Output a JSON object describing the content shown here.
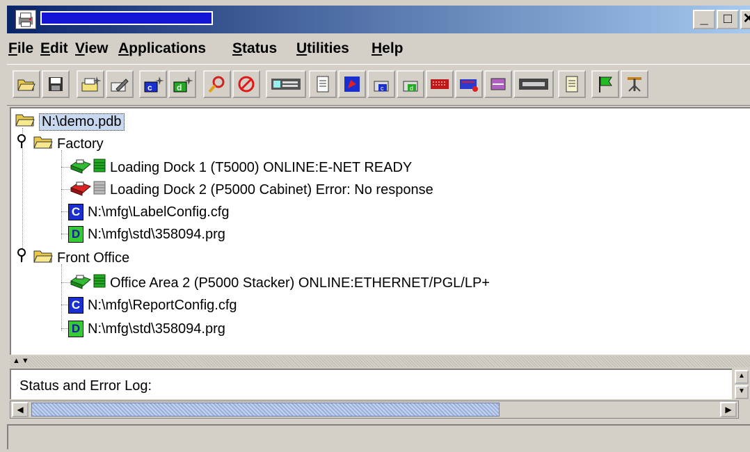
{
  "window": {
    "title": "",
    "buttons": {
      "minimize": "_",
      "maximize": "□",
      "close": "✕"
    }
  },
  "menu": [
    {
      "label": "File",
      "mnemonic": "F"
    },
    {
      "label": "Edit",
      "mnemonic": "E"
    },
    {
      "label": "View",
      "mnemonic": "V"
    },
    {
      "label": "Applications",
      "mnemonic": "A"
    },
    {
      "label": "Status",
      "mnemonic": "S"
    },
    {
      "label": "Utilities",
      "mnemonic": "U"
    },
    {
      "label": "Help",
      "mnemonic": "H"
    }
  ],
  "toolbar": [
    "open-folder-icon",
    "save-icon",
    "new-printer-icon",
    "edit-printer-icon",
    "new-config-icon",
    "new-data-icon",
    "find-icon",
    "stop-icon",
    "printer-panel-icon",
    "printer-document-icon",
    "print-icon",
    "config-printer-icon",
    "data-printer-icon",
    "status-red-icon",
    "status-blue-icon",
    "diagnostics-icon",
    "printer-panel-2-icon",
    "properties-icon",
    "flag-icon",
    "tools-icon"
  ],
  "tree": {
    "root": "N:\\demo.pdb",
    "groups": [
      {
        "label": "Factory",
        "items": [
          {
            "type": "printer",
            "status": "online",
            "label": "Loading Dock 1 (T5000) ONLINE:E-NET READY"
          },
          {
            "type": "printer",
            "status": "error",
            "label": "Loading Dock 2 (P5000 Cabinet) Error: No response"
          },
          {
            "type": "config",
            "badge": "C",
            "label": "N:\\mfg\\LabelConfig.cfg"
          },
          {
            "type": "data",
            "badge": "D",
            "label": "N:\\mfg\\std\\358094.prg"
          }
        ]
      },
      {
        "label": "Front Office",
        "items": [
          {
            "type": "printer",
            "status": "online",
            "label": "Office Area 2 (P5000 Stacker) ONLINE:ETHERNET/PGL/LP+"
          },
          {
            "type": "config",
            "badge": "C",
            "label": "N:\\mfg\\ReportConfig.cfg"
          },
          {
            "type": "data",
            "badge": "D",
            "label": "N:\\mfg\\std\\358094.prg"
          }
        ]
      }
    ]
  },
  "log": {
    "label": "Status and Error Log:"
  },
  "scroll": {
    "left": "◀",
    "right": "▶",
    "up": "▲",
    "down": "▼",
    "position": 0.68
  },
  "colors": {
    "title_start": "#0a246a",
    "title_end": "#a6caf0",
    "online": "#22aa22",
    "error": "#cc1111",
    "config": "#1a2fd0",
    "data": "#33cc33"
  }
}
